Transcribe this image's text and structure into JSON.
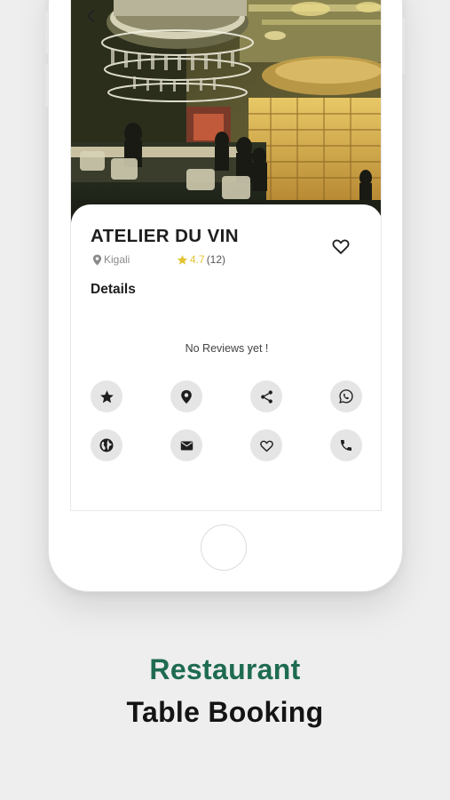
{
  "restaurant": {
    "name": "ATELIER DU VIN",
    "location": "Kigali",
    "rating": "4.7",
    "review_count": "(12)"
  },
  "details": {
    "section_title": "Details",
    "empty_reviews": "No Reviews yet !"
  },
  "actions": [
    {
      "icon": "star-icon"
    },
    {
      "icon": "map-pin-icon"
    },
    {
      "icon": "share-icon"
    },
    {
      "icon": "whatsapp-icon"
    },
    {
      "icon": "globe-icon"
    },
    {
      "icon": "mail-icon"
    },
    {
      "icon": "heart-icon"
    },
    {
      "icon": "phone-icon"
    }
  ],
  "promo": {
    "line1": "Restaurant",
    "line2": "Table Booking"
  },
  "colors": {
    "accent_green": "#1e6b52",
    "star_yellow": "#e3c433",
    "icon_bg": "#e5e5e5"
  }
}
